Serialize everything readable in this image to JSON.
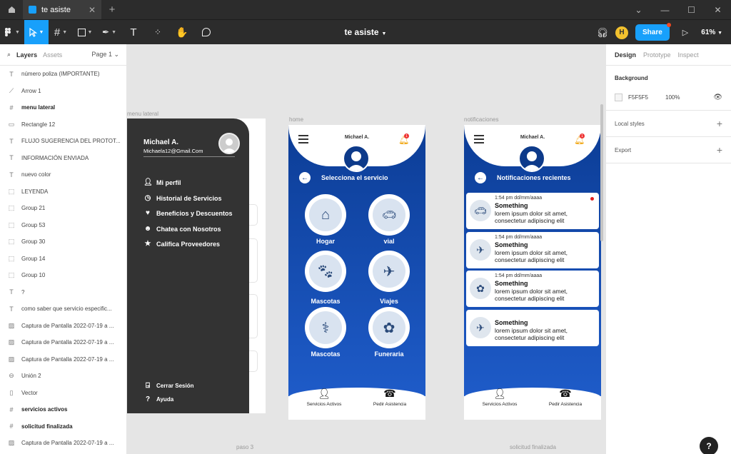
{
  "window": {
    "tab_title": "te asiste"
  },
  "toolbar": {
    "file_title": "te asiste",
    "avatar_initial": "H",
    "share_label": "Share",
    "zoom": "61%"
  },
  "left_panel": {
    "tabs": [
      "Layers",
      "Assets"
    ],
    "page_label": "Page 1",
    "layers": [
      {
        "icon": "text-icon",
        "glyph": "T",
        "label": "número poliza (IMPORTANTE)",
        "bold": false
      },
      {
        "icon": "arrow-icon",
        "glyph": "⟋",
        "label": "Arrow 1",
        "bold": false
      },
      {
        "icon": "frame-icon",
        "glyph": "#",
        "label": "menu lateral",
        "bold": true
      },
      {
        "icon": "rectangle-icon",
        "glyph": "▭",
        "label": "Rectangle 12",
        "bold": false
      },
      {
        "icon": "text-icon",
        "glyph": "T",
        "label": "FLUJO SUGERENCIA DEL PROTOT...",
        "bold": false
      },
      {
        "icon": "text-icon",
        "glyph": "T",
        "label": "INFORMACIÓN ENVIADA",
        "bold": false
      },
      {
        "icon": "text-icon",
        "glyph": "T",
        "label": "nuevo color",
        "bold": false
      },
      {
        "icon": "group-icon",
        "glyph": "⬚",
        "label": "LEYENDA",
        "bold": false
      },
      {
        "icon": "group-icon",
        "glyph": "⬚",
        "label": "Group 21",
        "bold": false
      },
      {
        "icon": "group-icon",
        "glyph": "⬚",
        "label": "Group 53",
        "bold": false
      },
      {
        "icon": "group-icon",
        "glyph": "⬚",
        "label": "Group 30",
        "bold": false
      },
      {
        "icon": "group-icon",
        "glyph": "⬚",
        "label": "Group 14",
        "bold": false
      },
      {
        "icon": "group-icon",
        "glyph": "⬚",
        "label": "Group 10",
        "bold": false
      },
      {
        "icon": "text-icon",
        "glyph": "T",
        "label": "?",
        "bold": false
      },
      {
        "icon": "text-icon",
        "glyph": "T",
        "label": "como saber que servicio especific...",
        "bold": false
      },
      {
        "icon": "image-icon",
        "glyph": "▨",
        "label": "Captura de Pantalla 2022-07-19 a ...",
        "bold": false
      },
      {
        "icon": "image-icon",
        "glyph": "▨",
        "label": "Captura de Pantalla 2022-07-19 a ...",
        "bold": false
      },
      {
        "icon": "image-icon",
        "glyph": "▨",
        "label": "Captura de Pantalla 2022-07-19 a ...",
        "bold": false
      },
      {
        "icon": "union-icon",
        "glyph": "⊖",
        "label": "Unión 2",
        "bold": false
      },
      {
        "icon": "vector-icon",
        "glyph": "▯",
        "label": "Vector",
        "bold": false
      },
      {
        "icon": "frame-icon",
        "glyph": "#",
        "label": "servicios activos",
        "bold": true
      },
      {
        "icon": "frame-icon",
        "glyph": "#",
        "label": "solicitud finalizada",
        "bold": true
      },
      {
        "icon": "image-icon",
        "glyph": "▨",
        "label": "Captura de Pantalla 2022-07-19 a ...",
        "bold": false
      }
    ]
  },
  "right_panel": {
    "tabs": [
      "Design",
      "Prototype",
      "Inspect"
    ],
    "background_title": "Background",
    "background_hex": "F5F5F5",
    "background_opacity": "100%",
    "local_styles": "Local styles",
    "export": "Export"
  },
  "canvas": {
    "frame_labels": {
      "menu": "menu lateral",
      "home": "home",
      "notif": "notificaciones",
      "paso3": "paso 3",
      "finalizada": "solicitud finalizada"
    },
    "menu": {
      "name": "Michael A.",
      "email": "Michaela12@Gmail.Com",
      "items": [
        "Mi perfil",
        "Historial de Servicios",
        "Beneficios y Descuentos",
        "Chatea con Nosotros",
        "Califica Proveedores"
      ],
      "footer": [
        "Cerrar Sesión",
        "Ayuda"
      ]
    },
    "home": {
      "user": "Michael A.",
      "badge": "1",
      "heading": "Selecciona el servicio",
      "services": [
        "Hogar",
        "vial",
        "Mascotas",
        "Viajes",
        "Mascotas",
        "Funeraria"
      ],
      "nav": [
        "Servicios Activos",
        "Pedir Asistencia"
      ]
    },
    "notificaciones": {
      "user": "Michael A.",
      "badge": "1",
      "heading": "Notificaciones recientes",
      "items": [
        {
          "time": "1:54 pm dd/mm/aaaa",
          "title": "Something",
          "body": "lorem ipsum dolor sit amet, consectetur adipiscing elit",
          "unread": true
        },
        {
          "time": "1:54 pm dd/mm/aaaa",
          "title": "Something",
          "body": "lorem ipsum dolor sit amet, consectetur adipiscing elit",
          "unread": false
        },
        {
          "time": "1:54 pm dd/mm/aaaa",
          "title": "Something",
          "body": "lorem ipsum dolor sit amet, consectetur adipiscing elit",
          "unread": false
        },
        {
          "time": "",
          "title": "Something",
          "body": "lorem ipsum dolor sit amet, consectetur adipiscing elit",
          "unread": false
        }
      ],
      "nav": [
        "Servicios Activos",
        "Pedir Asistencia"
      ]
    }
  },
  "colors": {
    "figma_blue": "#18a0fb",
    "app_blue": "#0c3d96",
    "menu_dark": "#333333",
    "canvas_bg": "#e5e5e5"
  }
}
